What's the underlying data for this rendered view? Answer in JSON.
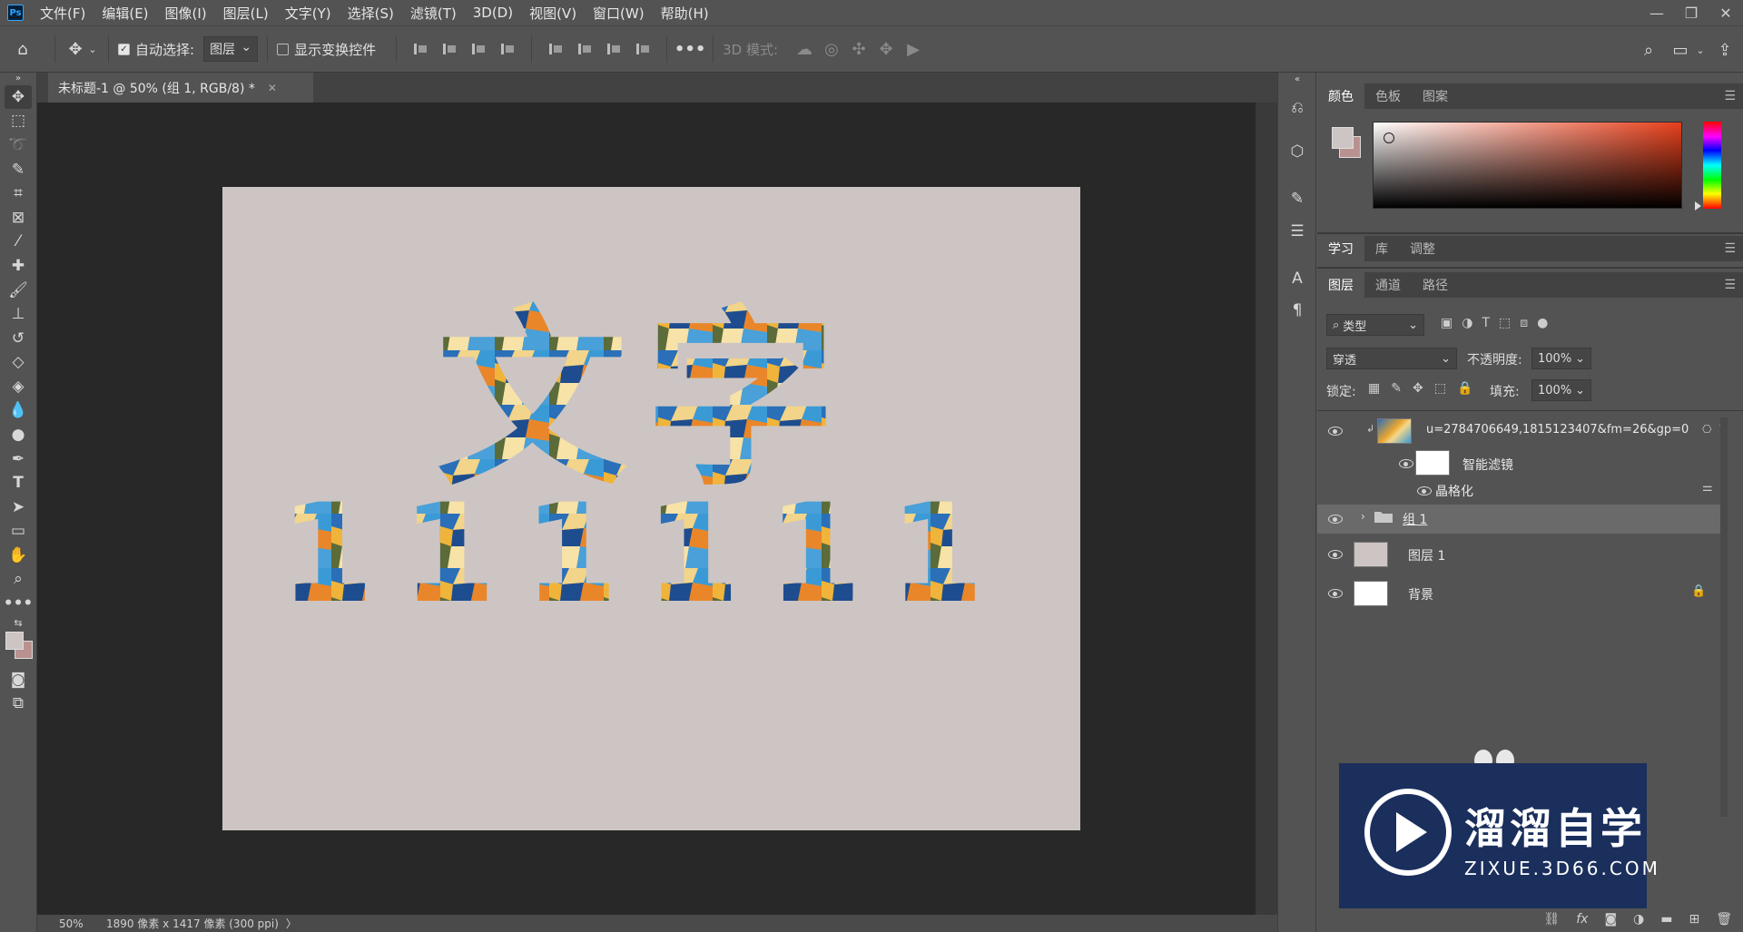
{
  "app": {
    "logo": "Ps"
  },
  "menu": [
    "文件(F)",
    "编辑(E)",
    "图像(I)",
    "图层(L)",
    "文字(Y)",
    "选择(S)",
    "滤镜(T)",
    "3D(D)",
    "视图(V)",
    "窗口(W)",
    "帮助(H)"
  ],
  "options": {
    "auto_select_label": "自动选择:",
    "auto_select_value": "图层",
    "show_transform_label": "显示变换控件",
    "mode_3d_label": "3D 模式:",
    "more": "•••"
  },
  "document": {
    "tab_title": "未标题-1 @ 50% (组 1, RGB/8) *",
    "canvas_color": "#cdc5c3",
    "main_text": "文字",
    "number_text": "111111"
  },
  "status": {
    "zoom": "50%",
    "info": "1890 像素 x 1417 像素 (300 ppi)",
    "arrow": "〉"
  },
  "color_panel": {
    "tabs": [
      "颜色",
      "色板",
      "图案"
    ],
    "active_tab": "颜色",
    "foreground": "#cdc5c3",
    "background": "#b9928f",
    "hue": "#e8401c"
  },
  "learn_panel": {
    "tabs": [
      "学习",
      "库",
      "调整"
    ]
  },
  "layers_panel": {
    "tabs": [
      "图层",
      "通道",
      "路径"
    ],
    "filter_value": "类型",
    "blend_mode": "穿透",
    "opacity_label": "不透明度:",
    "opacity_value": "100%",
    "lock_label": "锁定:",
    "fill_label": "填充:",
    "fill_value": "100%",
    "layers": [
      {
        "name": "u=2784706649,1815123407&fm=26&gp=0",
        "type": "smart-object"
      },
      {
        "name": "智能滤镜",
        "type": "smart-filter"
      },
      {
        "name": "晶格化",
        "type": "filter"
      },
      {
        "name": "组 1",
        "type": "group",
        "selected": true
      },
      {
        "name": "图层 1",
        "type": "layer"
      },
      {
        "name": "背景",
        "type": "background",
        "locked": true
      }
    ]
  },
  "watermark": {
    "title": "溜溜自学",
    "subtitle": "ZIXUE.3D66.COM"
  },
  "colors": {
    "ui_bg": "#535353",
    "canvas_bg": "#282828",
    "accent": "#31a8ff"
  }
}
